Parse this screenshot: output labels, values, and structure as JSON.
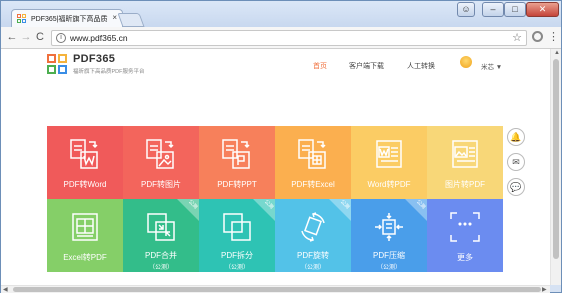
{
  "browser": {
    "tab_title": "PDF365|福昕旗下高品质",
    "tab_close": "×",
    "url": "www.pdf365.cn",
    "info_glyph": "i",
    "star_glyph": "☆",
    "menu_glyph": "⋮",
    "back_glyph": "←",
    "forward_glyph": "→",
    "reload_glyph": "C",
    "min_glyph": "–",
    "max_glyph": "□",
    "close_glyph": "✕"
  },
  "site": {
    "name": "PDF365",
    "slogan": "福昕旗下高品质PDF服务平台",
    "nav": {
      "home": "首页",
      "client": "客户端下载",
      "manual": "人工转换"
    },
    "user_name": "米芯 ▼"
  },
  "tiles": [
    {
      "label": "PDF转Word",
      "color": "#f05a5a",
      "icon": "pdf-to-word-icon"
    },
    {
      "label": "PDF转图片",
      "color": "#f3655c",
      "icon": "pdf-to-image-icon"
    },
    {
      "label": "PDF转PPT",
      "color": "#f7805b",
      "icon": "pdf-to-ppt-icon"
    },
    {
      "label": "PDF转Excel",
      "color": "#fbaf4f",
      "icon": "pdf-to-excel-icon"
    },
    {
      "label": "Word转PDF",
      "color": "#fbcc64",
      "icon": "word-to-pdf-icon"
    },
    {
      "label": "图片转PDF",
      "color": "#f8d778",
      "icon": "image-to-pdf-icon"
    },
    {
      "label": "Excel转PDF",
      "color": "#85cf68",
      "icon": "excel-to-pdf-icon"
    },
    {
      "label": "PDF合并",
      "sub": "（公测）",
      "badge": "公测",
      "color": "#33bd8a",
      "icon": "pdf-merge-icon"
    },
    {
      "label": "PDF拆分",
      "sub": "（公测）",
      "badge": "公测",
      "color": "#2ec3b4",
      "icon": "pdf-split-icon"
    },
    {
      "label": "PDF旋转",
      "sub": "（公测）",
      "badge": "公测",
      "color": "#53c2e8",
      "icon": "pdf-rotate-icon"
    },
    {
      "label": "PDF压缩",
      "sub": "（公测）",
      "badge": "公测",
      "color": "#4a9eea",
      "icon": "pdf-compress-icon"
    },
    {
      "label": "更多",
      "color": "#6b8cf0",
      "icon": "more-icon"
    }
  ],
  "side": {
    "bell": "🔔",
    "mail": "✉",
    "chat": "💬"
  }
}
